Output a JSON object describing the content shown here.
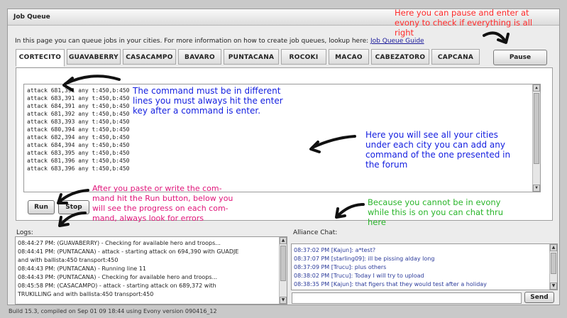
{
  "window": {
    "title": "Job Queue"
  },
  "intro": {
    "text": "In this page you can queue jobs in your cities. For more information on how to create job queues, lookup here: ",
    "link": "Job Queue Guide"
  },
  "tabs": [
    "CORTECITO",
    "GUAVABERRY",
    "CASACAMPO",
    "BAVARO",
    "PUNTACANA",
    "ROCOKI",
    "MACAO",
    "CABEZATORO",
    "CAPCANA"
  ],
  "buttons": {
    "pause": "Pause",
    "run": "Run",
    "stop": "Stop",
    "send": "Send"
  },
  "commands": [
    "attack 681,391 any t:450,b:450",
    "attack 683,391 any t:450,b:450",
    "attack 684,391 any t:450,b:450",
    "attack 681,392 any t:450,b:450",
    "attack 683,393 any t:450,b:450",
    "attack 680,394 any t:450,b:450",
    "attack 682,394 any t:450,b:450",
    "attack 684,394 any t:450,b:450",
    "attack 683,395 any t:450,b:450",
    "attack 681,396 any t:450,b:450",
    "attack 683,396 any t:450,b:450"
  ],
  "logs": {
    "label": "Logs:",
    "lines": [
      "08:44:27 PM: (GUAVABERRY) - Checking for available hero and troops...",
      "08:44:41 PM: (PUNTACANA) - attack - starting attack on 694,390 with GUADJE",
      "and with ballista:450 transport:450",
      "08:44:43 PM: (PUNTACANA) - Running line 11",
      "08:44:43 PM: (PUNTACANA) - Checking for available hero and troops...",
      "08:45:58 PM: (CASACAMPO) - attack - starting attack on 689,372 with",
      "TRUKILLING and with ballista:450 transport:450"
    ]
  },
  "chat": {
    "label": "Alliance Chat:",
    "lines": [
      "08:37:02 PM [Kajun]: a*test?",
      "08:37:07 PM [starling09]: ill be pissing alday long",
      "08:37:09 PM [Trucu]: plus others",
      "08:38:02 PM [Trucu]: Today I will try to upload",
      "08:38:35 PM [Kajun]: that figers that they would test after a holiday"
    ],
    "input_value": ""
  },
  "footer": "Build 15.3, compiled on Sep 01 09 18:44 using Evony version 090416_12",
  "annotations": {
    "pause_note": [
      "Here you can pause and enter at",
      "evony to check if everything is all",
      "right"
    ],
    "command_note": [
      "The command must be in different",
      "lines you must always hit the enter",
      "key after a command is enter."
    ],
    "cities_note": [
      "Here you will see all your cities",
      "under each city you can add any",
      "command of the one presented in",
      "the forum"
    ],
    "run_note": [
      "After you paste or write the com-",
      "mand hit the Run button, below you",
      "will see the progress on each com-",
      "mand, always look for errors"
    ],
    "chat_note": [
      "Because you cannot be in evony",
      "while this is on you can chat thru",
      "here"
    ]
  },
  "colors": {
    "note_red": "#ff2a2a",
    "note_blue": "#1520e0",
    "note_magenta": "#e0157a",
    "note_green": "#29b52a",
    "chat_text": "#2a3a9a"
  }
}
